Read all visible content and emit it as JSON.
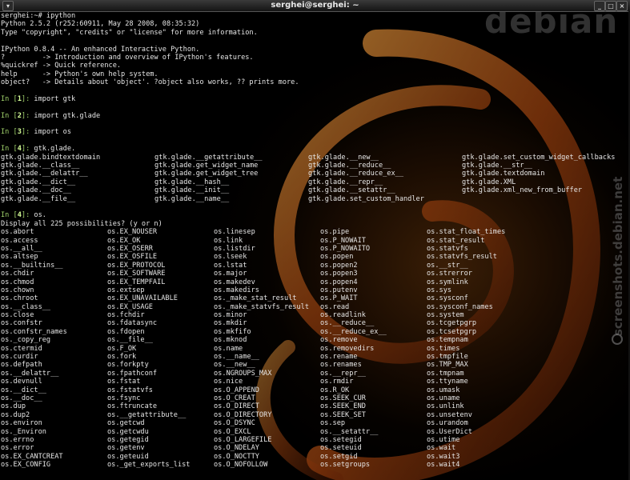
{
  "window": {
    "title": "serghei@serghei: ~"
  },
  "branding": {
    "logo_text": "debian",
    "watermark": "screenshots.debian.net"
  },
  "colors": {
    "prompt_green": "#9fd06a",
    "text": "#e6e6e6",
    "background": "#000000",
    "swirl": "#c8621a"
  },
  "terminal": {
    "header_lines": [
      "serghei:~# ipython",
      "Python 2.5.2 (r252:60911, May 28 2008, 08:35:32)",
      "Type \"copyright\", \"credits\" or \"license\" for more information.",
      "",
      "IPython 0.8.4 -- An enhanced Interactive Python.",
      "?         -> Introduction and overview of IPython's features.",
      "%quickref -> Quick reference.",
      "help      -> Python's own help system.",
      "object?   -> Details about 'object'. ?object also works, ?? prints more."
    ],
    "prompts": [
      {
        "label": "In [",
        "num": "1",
        "end": "]: ",
        "cmd": "import gtk"
      },
      {
        "label": "In [",
        "num": "2",
        "end": "]: ",
        "cmd": "import gtk.glade"
      },
      {
        "label": "In [",
        "num": "3",
        "end": "]: ",
        "cmd": "import os"
      },
      {
        "label": "In [",
        "num": "4",
        "end": "]: ",
        "cmd": "gtk.glade."
      },
      {
        "label": "In [",
        "num": "4",
        "end": "]: ",
        "cmd": "os."
      }
    ],
    "glade_completions": [
      [
        "gtk.glade.bindtextdomain",
        "gtk.glade.__getattribute__",
        "gtk.glade.__new__",
        "gtk.glade.set_custom_widget_callbacks"
      ],
      [
        "gtk.glade.__class__",
        "gtk.glade.get_widget_name",
        "gtk.glade.__reduce__",
        "gtk.glade.__str__"
      ],
      [
        "gtk.glade.__delattr__",
        "gtk.glade.get_widget_tree",
        "gtk.glade.__reduce_ex__",
        "gtk.glade.textdomain"
      ],
      [
        "gtk.glade.__dict__",
        "gtk.glade.__hash__",
        "gtk.glade.__repr__",
        "gtk.glade.XML"
      ],
      [
        "gtk.glade.__doc__",
        "gtk.glade.__init__",
        "gtk.glade.__setattr__",
        "gtk.glade.xml_new_from_buffer"
      ],
      [
        "gtk.glade.__file__",
        "gtk.glade.__name__",
        "gtk.glade.set_custom_handler",
        ""
      ]
    ],
    "display_prompt": "Display all 225 possibilities? (y or n)",
    "os_completions": [
      [
        "os.abort",
        "os.EX_NOUSER",
        "os.linesep",
        "os.pipe",
        "os.stat_float_times"
      ],
      [
        "os.access",
        "os.EX_OK",
        "os.link",
        "os.P_NOWAIT",
        "os.stat_result"
      ],
      [
        "os.__all__",
        "os.EX_OSERR",
        "os.listdir",
        "os.P_NOWAITO",
        "os.statvfs"
      ],
      [
        "os.altsep",
        "os.EX_OSFILE",
        "os.lseek",
        "os.popen",
        "os.statvfs_result"
      ],
      [
        "os.__builtins__",
        "os.EX_PROTOCOL",
        "os.lstat",
        "os.popen2",
        "os.__str__"
      ],
      [
        "os.chdir",
        "os.EX_SOFTWARE",
        "os.major",
        "os.popen3",
        "os.strerror"
      ],
      [
        "os.chmod",
        "os.EX_TEMPFAIL",
        "os.makedev",
        "os.popen4",
        "os.symlink"
      ],
      [
        "os.chown",
        "os.extsep",
        "os.makedirs",
        "os.putenv",
        "os.sys"
      ],
      [
        "os.chroot",
        "os.EX_UNAVAILABLE",
        "os._make_stat_result",
        "os.P_WAIT",
        "os.sysconf"
      ],
      [
        "os.__class__",
        "os.EX_USAGE",
        "os._make_statvfs_result",
        "os.read",
        "os.sysconf_names"
      ],
      [
        "os.close",
        "os.fchdir",
        "os.minor",
        "os.readlink",
        "os.system"
      ],
      [
        "os.confstr",
        "os.fdatasync",
        "os.mkdir",
        "os.__reduce__",
        "os.tcgetpgrp"
      ],
      [
        "os.confstr_names",
        "os.fdopen",
        "os.mkfifo",
        "os.__reduce_ex__",
        "os.tcsetpgrp"
      ],
      [
        "os._copy_reg",
        "os.__file__",
        "os.mknod",
        "os.remove",
        "os.tempnam"
      ],
      [
        "os.ctermid",
        "os.F_OK",
        "os.name",
        "os.removedirs",
        "os.times"
      ],
      [
        "os.curdir",
        "os.fork",
        "os.__name__",
        "os.rename",
        "os.tmpfile"
      ],
      [
        "os.defpath",
        "os.forkpty",
        "os.__new__",
        "os.renames",
        "os.TMP_MAX"
      ],
      [
        "os.__delattr__",
        "os.fpathconf",
        "os.NGROUPS_MAX",
        "os.__repr__",
        "os.tmpnam"
      ],
      [
        "os.devnull",
        "os.fstat",
        "os.nice",
        "os.rmdir",
        "os.ttyname"
      ],
      [
        "os.__dict__",
        "os.fstatvfs",
        "os.O_APPEND",
        "os.R_OK",
        "os.umask"
      ],
      [
        "os.__doc__",
        "os.fsync",
        "os.O_CREAT",
        "os.SEEK_CUR",
        "os.uname"
      ],
      [
        "os.dup",
        "os.ftruncate",
        "os.O_DIRECT",
        "os.SEEK_END",
        "os.unlink"
      ],
      [
        "os.dup2",
        "os.__getattribute__",
        "os.O_DIRECTORY",
        "os.SEEK_SET",
        "os.unsetenv"
      ],
      [
        "os.environ",
        "os.getcwd",
        "os.O_DSYNC",
        "os.sep",
        "os.urandom"
      ],
      [
        "os._Environ",
        "os.getcwdu",
        "os.O_EXCL",
        "os.__setattr__",
        "os.UserDict"
      ],
      [
        "os.errno",
        "os.getegid",
        "os.O_LARGEFILE",
        "os.setegid",
        "os.utime"
      ],
      [
        "os.error",
        "os.getenv",
        "os.O_NDELAY",
        "os.seteuid",
        "os.wait"
      ],
      [
        "os.EX_CANTCREAT",
        "os.geteuid",
        "os.O_NOCTTY",
        "os.setgid",
        "os.wait3"
      ],
      [
        "os.EX_CONFIG",
        "os._get_exports_list",
        "os.O_NOFOLLOW",
        "os.setgroups",
        "os.wait4"
      ]
    ]
  }
}
